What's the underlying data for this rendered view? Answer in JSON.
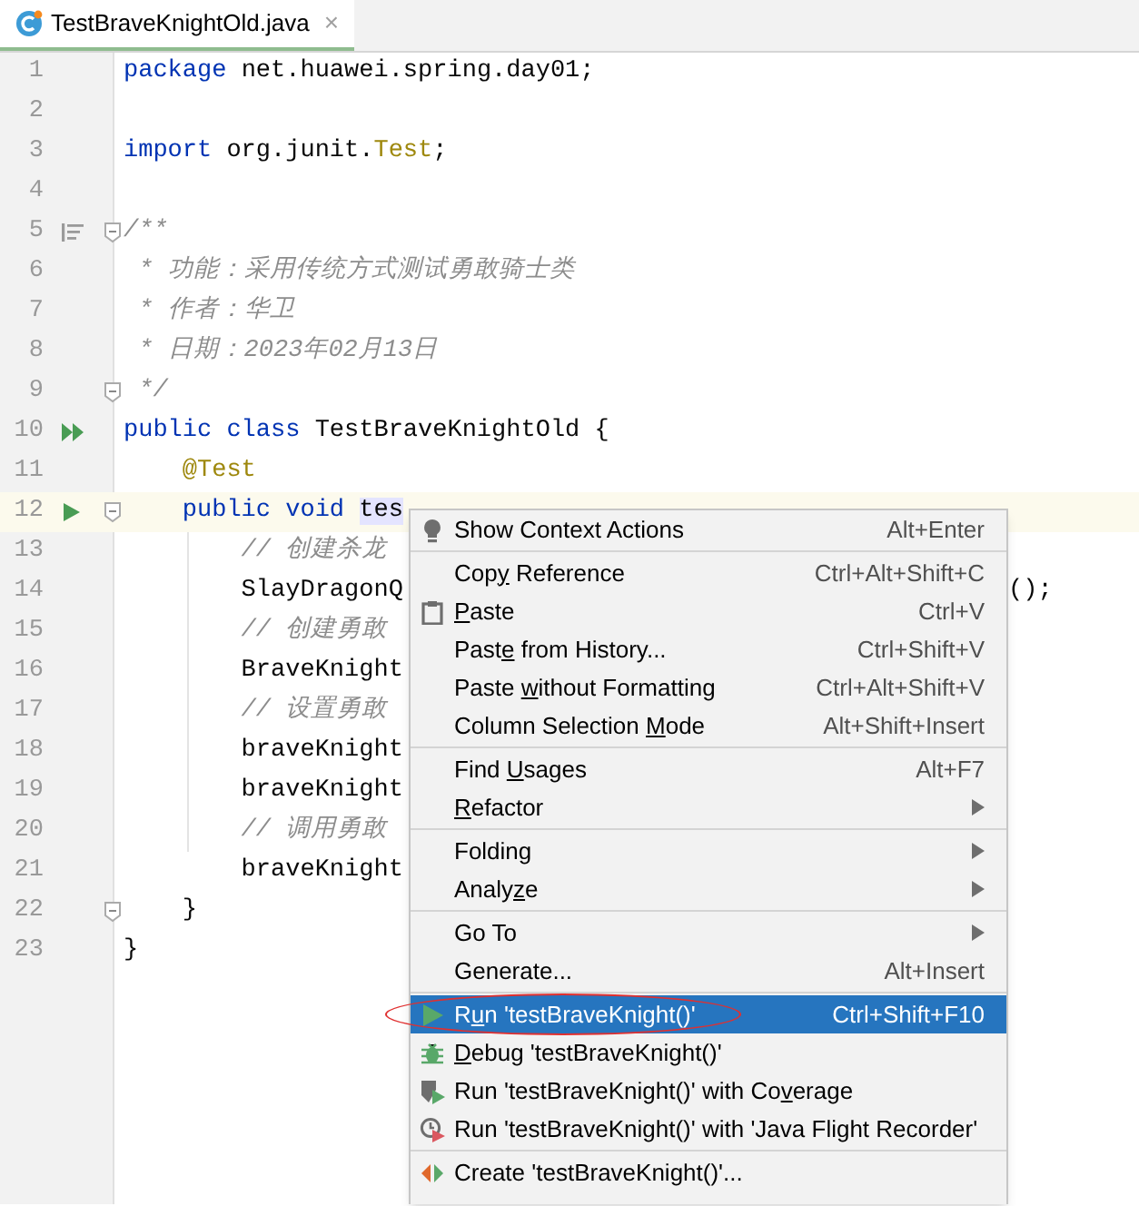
{
  "tab": {
    "title": "TestBraveKnightOld.java",
    "close": "×",
    "selected": true
  },
  "editor": {
    "lines": [
      {
        "number": "1",
        "tokens": [
          {
            "kind": "keyword",
            "text": "package"
          },
          {
            "kind": "plain",
            "text": " net.huawei.spring.day01;"
          }
        ]
      },
      {
        "number": "2"
      },
      {
        "number": "3",
        "tokens": [
          {
            "kind": "keyword",
            "text": "import"
          },
          {
            "kind": "plain",
            "text": " org.junit."
          },
          {
            "kind": "class",
            "text": "Test"
          },
          {
            "kind": "plain",
            "text": ";"
          }
        ]
      },
      {
        "number": "4"
      },
      {
        "number": "5",
        "fold": true,
        "tokens": [
          {
            "kind": "comment",
            "text": "/**"
          }
        ]
      },
      {
        "number": "6",
        "tokens": [
          {
            "kind": "comment",
            "text": " * 功能：采用传统方式测试勇敢骑士类"
          }
        ]
      },
      {
        "number": "7",
        "tokens": [
          {
            "kind": "comment",
            "text": " * 作者：华卫"
          }
        ]
      },
      {
        "number": "8",
        "tokens": [
          {
            "kind": "comment",
            "text": " * 日期：2023年02月13日"
          }
        ]
      },
      {
        "number": "9",
        "fold": true,
        "tokens": [
          {
            "kind": "comment",
            "text": " */"
          }
        ]
      },
      {
        "number": "10",
        "tokens": [
          {
            "kind": "keyword",
            "text": "public class"
          },
          {
            "kind": "plain",
            "text": " TestBraveKnightOld {"
          }
        ]
      },
      {
        "number": "11",
        "tokens": [
          {
            "kind": "annotation",
            "text": "    @Test"
          }
        ]
      },
      {
        "number": "12",
        "fold": true,
        "current": true,
        "tokens": [
          {
            "kind": "keyword",
            "text": "    public void"
          },
          {
            "kind": "highlight",
            "text": " tes"
          }
        ]
      },
      {
        "number": "13",
        "tokens": [
          {
            "kind": "comment",
            "text": "        // 创建杀龙"
          }
        ]
      },
      {
        "number": "14",
        "tokens": [
          {
            "kind": "plain",
            "text": "        SlayDragonQ"
          }
        ],
        "tail": "();"
      },
      {
        "number": "15",
        "tokens": [
          {
            "kind": "comment",
            "text": "        // 创建勇敢"
          }
        ]
      },
      {
        "number": "16",
        "tokens": [
          {
            "kind": "plain",
            "text": "        BraveKnight"
          }
        ]
      },
      {
        "number": "17",
        "tokens": [
          {
            "kind": "comment",
            "text": "        // 设置勇敢"
          }
        ]
      },
      {
        "number": "18",
        "tokens": [
          {
            "kind": "plain",
            "text": "        braveKnight"
          }
        ]
      },
      {
        "number": "19",
        "tokens": [
          {
            "kind": "plain",
            "text": "        braveKnight"
          }
        ]
      },
      {
        "number": "20",
        "tokens": [
          {
            "kind": "comment",
            "text": "        // 调用勇敢"
          }
        ]
      },
      {
        "number": "21",
        "tokens": [
          {
            "kind": "plain",
            "text": "        braveKnight"
          }
        ]
      },
      {
        "number": "22",
        "fold": true,
        "tokens": [
          {
            "kind": "plain",
            "text": "    }"
          }
        ]
      },
      {
        "number": "23",
        "tokens": [
          {
            "kind": "plain",
            "text": "}"
          }
        ]
      }
    ]
  },
  "context_menu": {
    "groups": [
      [
        {
          "label": "Show Context Actions",
          "shortcut": "Alt+Enter",
          "selected": false
        }
      ],
      [
        {
          "label": "Copy Reference",
          "shortcut": "Ctrl+Alt+Shift+C",
          "selected": false
        },
        {
          "label": "Paste",
          "shortcut": "Ctrl+V",
          "selected": false
        },
        {
          "label": "Paste from History...",
          "shortcut": "Ctrl+Shift+V",
          "selected": false
        },
        {
          "label": "Paste without Formatting",
          "shortcut": "Ctrl+Alt+Shift+V",
          "selected": false
        },
        {
          "label": "Column Selection Mode",
          "shortcut": "Alt+Shift+Insert",
          "selected": false
        }
      ],
      [
        {
          "label": "Find Usages",
          "shortcut": "Alt+F7",
          "selected": false
        },
        {
          "label": "Refactor",
          "submenu": true,
          "selected": false
        }
      ],
      [
        {
          "label": "Folding",
          "submenu": true,
          "selected": false
        },
        {
          "label": "Analyze",
          "submenu": true,
          "selected": false
        }
      ],
      [
        {
          "label": "Go To",
          "submenu": true,
          "selected": false
        },
        {
          "label": "Generate...",
          "shortcut": "Alt+Insert",
          "selected": false
        }
      ],
      [
        {
          "label": "Run 'testBraveKnight()'",
          "shortcut": "Ctrl+Shift+F10",
          "selected": true,
          "circled": true
        },
        {
          "label": "Debug 'testBraveKnight()'",
          "selected": false
        },
        {
          "label": "Run 'testBraveKnight()' with Coverage",
          "selected": false
        },
        {
          "label": "Run 'testBraveKnight()' with 'Java Flight Recorder'",
          "selected": false
        }
      ],
      [
        {
          "label": "Create 'testBraveKnight()'...",
          "selected": false
        }
      ]
    ]
  }
}
